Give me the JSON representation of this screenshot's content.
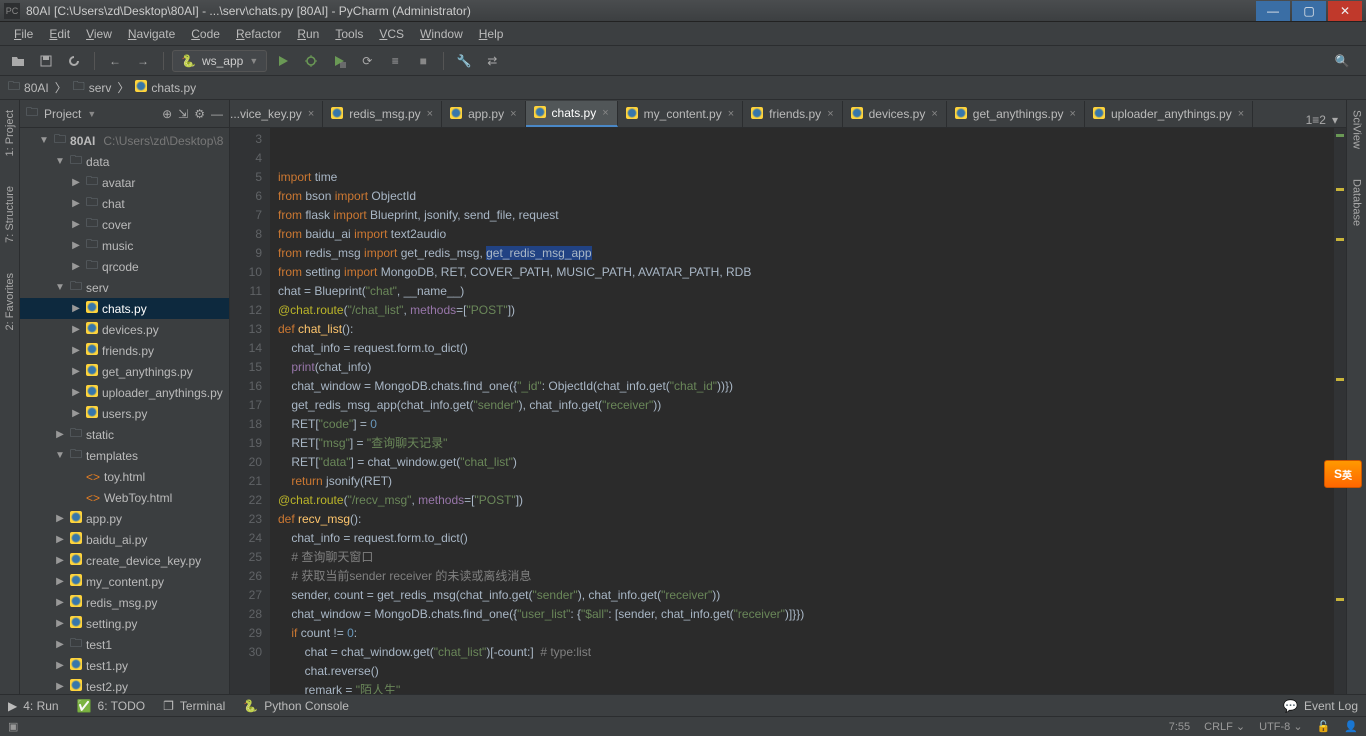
{
  "window": {
    "title": "80AI [C:\\Users\\zd\\Desktop\\80AI] - ...\\serv\\chats.py [80AI] - PyCharm (Administrator)",
    "icon_letters": "PC"
  },
  "menu": [
    "File",
    "Edit",
    "View",
    "Navigate",
    "Code",
    "Refactor",
    "Run",
    "Tools",
    "VCS",
    "Window",
    "Help"
  ],
  "run_config": "ws_app",
  "breadcrumb": [
    "80AI",
    "serv",
    "chats.py"
  ],
  "project_panel": {
    "title": "Project",
    "root": {
      "name": "80AI",
      "path": "C:\\Users\\zd\\Desktop\\8"
    }
  },
  "tree": [
    {
      "d": 2,
      "ic": "folder",
      "exp": "open",
      "lbl": "data"
    },
    {
      "d": 3,
      "ic": "folder",
      "exp": "closed",
      "lbl": "avatar"
    },
    {
      "d": 3,
      "ic": "folder",
      "exp": "closed",
      "lbl": "chat"
    },
    {
      "d": 3,
      "ic": "folder",
      "exp": "closed",
      "lbl": "cover"
    },
    {
      "d": 3,
      "ic": "folder",
      "exp": "closed",
      "lbl": "music"
    },
    {
      "d": 3,
      "ic": "folder",
      "exp": "closed",
      "lbl": "qrcode"
    },
    {
      "d": 2,
      "ic": "folder",
      "exp": "open",
      "lbl": "serv"
    },
    {
      "d": 3,
      "ic": "py",
      "exp": "closed",
      "lbl": "chats.py",
      "sel": true
    },
    {
      "d": 3,
      "ic": "py",
      "exp": "closed",
      "lbl": "devices.py"
    },
    {
      "d": 3,
      "ic": "py",
      "exp": "closed",
      "lbl": "friends.py"
    },
    {
      "d": 3,
      "ic": "py",
      "exp": "closed",
      "lbl": "get_anythings.py"
    },
    {
      "d": 3,
      "ic": "py",
      "exp": "closed",
      "lbl": "uploader_anythings.py"
    },
    {
      "d": 3,
      "ic": "py",
      "exp": "closed",
      "lbl": "users.py"
    },
    {
      "d": 2,
      "ic": "folder",
      "exp": "closed",
      "lbl": "static"
    },
    {
      "d": 2,
      "ic": "folder",
      "exp": "open",
      "lbl": "templates"
    },
    {
      "d": 3,
      "ic": "html",
      "exp": "none",
      "lbl": "toy.html"
    },
    {
      "d": 3,
      "ic": "html",
      "exp": "none",
      "lbl": "WebToy.html"
    },
    {
      "d": 2,
      "ic": "py",
      "exp": "closed",
      "lbl": "app.py"
    },
    {
      "d": 2,
      "ic": "py",
      "exp": "closed",
      "lbl": "baidu_ai.py"
    },
    {
      "d": 2,
      "ic": "py",
      "exp": "closed",
      "lbl": "create_device_key.py"
    },
    {
      "d": 2,
      "ic": "py",
      "exp": "closed",
      "lbl": "my_content.py"
    },
    {
      "d": 2,
      "ic": "py",
      "exp": "closed",
      "lbl": "redis_msg.py"
    },
    {
      "d": 2,
      "ic": "py",
      "exp": "closed",
      "lbl": "setting.py"
    },
    {
      "d": 2,
      "ic": "folder",
      "exp": "closed",
      "lbl": "test1"
    },
    {
      "d": 2,
      "ic": "py",
      "exp": "closed",
      "lbl": "test1.py"
    },
    {
      "d": 2,
      "ic": "py",
      "exp": "closed",
      "lbl": "test2.py"
    }
  ],
  "left_tabs": [
    "1: Project",
    "7: Structure",
    "2: Favorites"
  ],
  "right_tabs": [
    "SciView",
    "Database"
  ],
  "editor_tabs": [
    {
      "label": "...vice_key.py",
      "partial": true
    },
    {
      "label": "redis_msg.py"
    },
    {
      "label": "app.py"
    },
    {
      "label": "chats.py",
      "active": true
    },
    {
      "label": "my_content.py"
    },
    {
      "label": "friends.py"
    },
    {
      "label": "devices.py"
    },
    {
      "label": "get_anythings.py"
    },
    {
      "label": "uploader_anythings.py"
    }
  ],
  "tabs_more": "1≡2",
  "gutter_start": 3,
  "gutter_end": 30,
  "code_lines": [
    [
      [
        "k-orange",
        "import "
      ],
      [
        "",
        "time"
      ]
    ],
    [
      [
        "k-orange",
        "from "
      ],
      [
        "",
        "bson "
      ],
      [
        "k-orange",
        "import "
      ],
      [
        "",
        "ObjectId"
      ]
    ],
    [
      [
        "k-orange",
        "from "
      ],
      [
        "",
        "flask "
      ],
      [
        "k-orange",
        "import "
      ],
      [
        "",
        "Blueprint"
      ],
      [
        "k-dim",
        ", "
      ],
      [
        "",
        "jsonify"
      ],
      [
        "k-dim",
        ", "
      ],
      [
        "",
        "send_file"
      ],
      [
        "k-dim",
        ", "
      ],
      [
        "",
        "request"
      ]
    ],
    [
      [
        "k-orange",
        "from "
      ],
      [
        "",
        "baidu_ai "
      ],
      [
        "k-orange",
        "import "
      ],
      [
        "",
        "text2audio"
      ]
    ],
    [
      [
        "k-orange",
        "from "
      ],
      [
        "",
        "redis_msg "
      ],
      [
        "k-orange",
        "import "
      ],
      [
        "",
        "get_redis_msg"
      ],
      [
        "k-dim",
        ", "
      ],
      [
        "hl-bg",
        "get_redis_msg_app"
      ]
    ],
    [
      [
        "k-orange",
        "from "
      ],
      [
        "",
        "setting "
      ],
      [
        "k-orange",
        "import "
      ],
      [
        "",
        "MongoDB"
      ],
      [
        "k-dim",
        ", "
      ],
      [
        "",
        "RET"
      ],
      [
        "k-dim",
        ", "
      ],
      [
        "",
        "COVER_PATH"
      ],
      [
        "k-dim",
        ", "
      ],
      [
        "",
        "MUSIC_PATH"
      ],
      [
        "k-dim",
        ", "
      ],
      [
        "",
        "AVATAR_PATH"
      ],
      [
        "k-dim",
        ", "
      ],
      [
        "",
        "RDB"
      ]
    ],
    [
      [
        "",
        "chat = Blueprint("
      ],
      [
        "k-green",
        "\"chat\""
      ],
      [
        "",
        ", __name__)"
      ]
    ],
    [
      [
        "k-olive",
        "@chat.route"
      ],
      [
        "",
        "("
      ],
      [
        "k-green",
        "\"/chat_list\""
      ],
      [
        "",
        ", "
      ],
      [
        "k-purple",
        "methods"
      ],
      [
        "",
        "=["
      ],
      [
        "k-green",
        "\"POST\""
      ],
      [
        "",
        "])"
      ]
    ],
    [
      [
        "k-orange",
        "def "
      ],
      [
        "k-yellow",
        "chat_list"
      ],
      [
        "",
        "():"
      ]
    ],
    [
      [
        "",
        "    chat_info = request.form.to_dict()"
      ]
    ],
    [
      [
        "",
        "    "
      ],
      [
        "k-purple",
        "print"
      ],
      [
        "",
        "(chat_info)"
      ]
    ],
    [
      [
        "",
        "    chat_window = MongoDB.chats.find_one({"
      ],
      [
        "k-green",
        "\"_id\""
      ],
      [
        "",
        ": ObjectId(chat_info.get("
      ],
      [
        "k-green",
        "\"chat_id\""
      ],
      [
        "",
        "))})"
      ]
    ],
    [
      [
        "",
        "    get_redis_msg_app(chat_info.get("
      ],
      [
        "k-green",
        "\"sender\""
      ],
      [
        "",
        "), chat_info.get("
      ],
      [
        "k-green",
        "\"receiver\""
      ],
      [
        "",
        "))"
      ]
    ],
    [
      [
        "",
        "    RET["
      ],
      [
        "k-green",
        "\"code\""
      ],
      [
        "",
        "] = "
      ],
      [
        "k-blue",
        "0"
      ]
    ],
    [
      [
        "",
        "    RET["
      ],
      [
        "k-green",
        "\"msg\""
      ],
      [
        "",
        "] = "
      ],
      [
        "k-green",
        "\"查询聊天记录\""
      ]
    ],
    [
      [
        "",
        "    RET["
      ],
      [
        "k-green",
        "\"data\""
      ],
      [
        "",
        "] = chat_window.get("
      ],
      [
        "k-green",
        "\"chat_list\""
      ],
      [
        "",
        ")"
      ]
    ],
    [
      [
        "",
        "    "
      ],
      [
        "k-orange",
        "return "
      ],
      [
        "",
        "jsonify(RET)"
      ]
    ],
    [
      [
        "k-olive",
        "@chat.route"
      ],
      [
        "",
        "("
      ],
      [
        "k-green",
        "\"/recv_msg\""
      ],
      [
        "",
        ", "
      ],
      [
        "k-purple",
        "methods"
      ],
      [
        "",
        "=["
      ],
      [
        "k-green",
        "\"POST\""
      ],
      [
        "",
        "])"
      ]
    ],
    [
      [
        "k-orange",
        "def "
      ],
      [
        "k-yellow",
        "recv_msg"
      ],
      [
        "",
        "():"
      ]
    ],
    [
      [
        "",
        "    chat_info = request.form.to_dict()"
      ]
    ],
    [
      [
        "",
        "    "
      ],
      [
        "k-gray",
        "# 查询聊天窗口"
      ]
    ],
    [
      [
        "",
        "    "
      ],
      [
        "k-gray",
        "# 获取当前sender receiver 的未读或离线消息"
      ]
    ],
    [
      [
        "",
        "    sender, count = get_redis_msg(chat_info.get("
      ],
      [
        "k-green",
        "\"sender\""
      ],
      [
        "",
        "), chat_info.get("
      ],
      [
        "k-green",
        "\"receiver\""
      ],
      [
        "",
        "))"
      ]
    ],
    [
      [
        "",
        "    chat_window = MongoDB.chats.find_one({"
      ],
      [
        "k-green",
        "\"user_list\""
      ],
      [
        "",
        ": {"
      ],
      [
        "k-green",
        "\"$all\""
      ],
      [
        "",
        ": [sender, chat_info.get("
      ],
      [
        "k-green",
        "\"receiver\""
      ],
      [
        "",
        ")]}})"
      ]
    ],
    [
      [
        "",
        "    "
      ],
      [
        "k-orange",
        "if "
      ],
      [
        "",
        "count != "
      ],
      [
        "k-blue",
        "0"
      ],
      [
        "",
        ":"
      ]
    ],
    [
      [
        "",
        "        chat = chat_window.get("
      ],
      [
        "k-green",
        "\"chat_list\""
      ],
      [
        "",
        ")[-count:]  "
      ],
      [
        "k-gray",
        "# type:list"
      ]
    ],
    [
      [
        "",
        "        chat.reverse()"
      ]
    ],
    [
      [
        "",
        "        remark = "
      ],
      [
        "k-green",
        "\"陌人生\""
      ]
    ]
  ],
  "bottom_tools": [
    "4: Run",
    "6: TODO",
    "Terminal",
    "Python Console"
  ],
  "event_log": "Event Log",
  "status": {
    "caret": "7:55",
    "line_end": "CRLF",
    "encoding": "UTF-8"
  },
  "ime": "英"
}
